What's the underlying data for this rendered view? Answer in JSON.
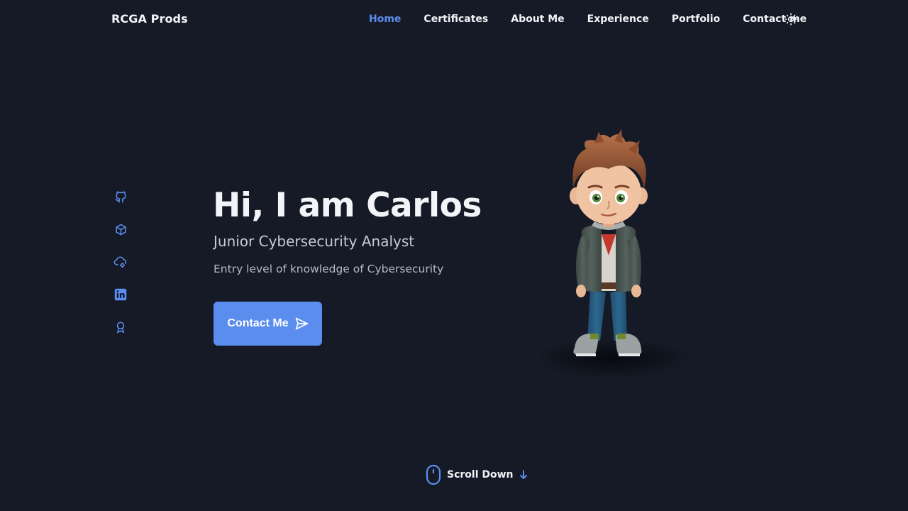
{
  "header": {
    "logo": "RCGA Prods",
    "nav": [
      {
        "label": "Home",
        "active": true
      },
      {
        "label": "Certificates",
        "active": false
      },
      {
        "label": "About Me",
        "active": false
      },
      {
        "label": "Experience",
        "active": false
      },
      {
        "label": "Portfolio",
        "active": false
      },
      {
        "label": "Contact me",
        "active": false
      }
    ],
    "theme_icon": "sun-icon"
  },
  "social": [
    {
      "icon": "github-icon"
    },
    {
      "icon": "cube-icon"
    },
    {
      "icon": "cloud-icon"
    },
    {
      "icon": "linkedin-icon"
    },
    {
      "icon": "award-icon"
    }
  ],
  "hero": {
    "title": "Hi, I am Carlos",
    "subtitle": "Junior Cybersecurity Analyst",
    "description": "Entry level of knowledge of Cybersecurity",
    "button_label": "Contact Me",
    "button_icon": "send-icon"
  },
  "scroll": {
    "label": "Scroll Down",
    "icon": "mouse-icon",
    "arrow_icon": "arrow-down-icon"
  },
  "colors": {
    "background": "#151a26",
    "accent": "#5b8def",
    "text": "#f3f4f7",
    "muted": "#b6b9c4"
  }
}
